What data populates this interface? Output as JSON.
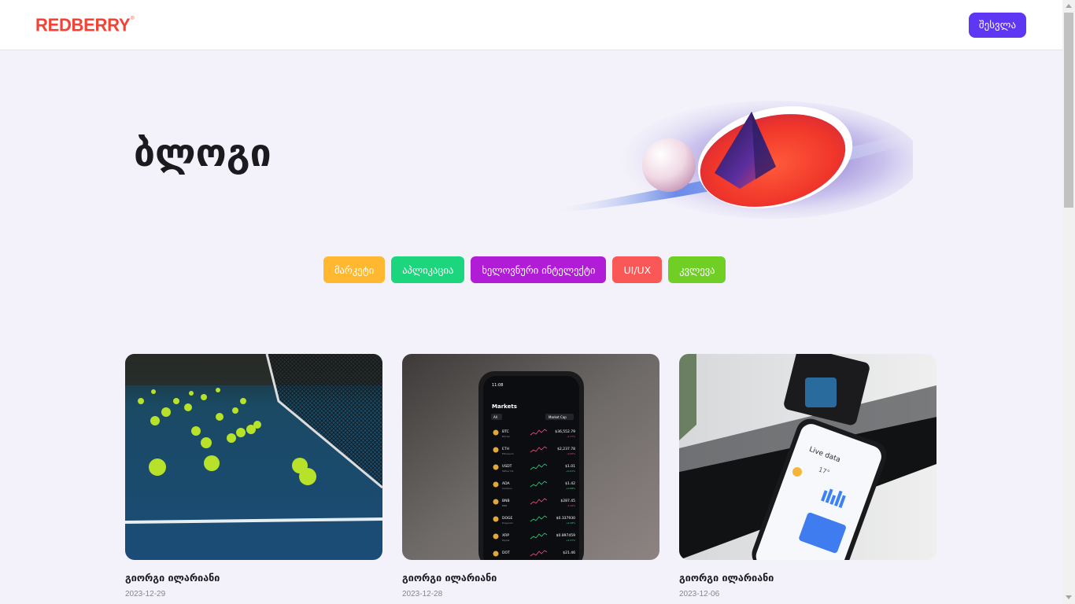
{
  "header": {
    "logo_text": "REDBERRY",
    "logo_mark": "®",
    "login_label": "შესვლა"
  },
  "hero": {
    "title": "ბლოგი"
  },
  "categories": [
    {
      "label": "მარკეტი",
      "color": "#FFB82F"
    },
    {
      "label": "აპლიკაცია",
      "color": "#1CD67D"
    },
    {
      "label": "ხელოვნური ინტელექტი",
      "color": "#B11CD6"
    },
    {
      "label": "UI/UX",
      "color": "#FA5757"
    },
    {
      "label": "კვლევა",
      "color": "#70CF25"
    }
  ],
  "posts": [
    {
      "author": "გიორგი ილარიანი",
      "date": "2023-12-29",
      "image": "tennis-balls-photo"
    },
    {
      "author": "გიორგი ილარიანი",
      "date": "2023-12-28",
      "image": "crypto-markets-phone-photo",
      "phone": {
        "time": "11:08",
        "title": "Markets",
        "tab_all": "All",
        "filter": "Market Cap",
        "coins": [
          {
            "symbol": "BTC",
            "name": "Bitcoin",
            "price": "$36,552.79",
            "change": "-0.77%"
          },
          {
            "symbol": "ETH",
            "name": "Ethereum",
            "price": "$2,237.78",
            "change": "-0.05%"
          },
          {
            "symbol": "USDT",
            "name": "Tether US",
            "price": "$1.01",
            "change": "+0.01%"
          },
          {
            "symbol": "ADA",
            "name": "Cardano",
            "price": "$1.42",
            "change": "+0.68%"
          },
          {
            "symbol": "BNB",
            "name": "BNB",
            "price": "$287.45",
            "change": "-1.44%"
          },
          {
            "symbol": "DOGE",
            "name": "Dogecoin",
            "price": "$0.337930",
            "change": "+2.08%"
          },
          {
            "symbol": "XRP",
            "name": "Ripple",
            "price": "$0.897459",
            "change": "+2.47%"
          },
          {
            "symbol": "DOT",
            "name": "",
            "price": "$21.46",
            "change": ""
          }
        ]
      }
    },
    {
      "author": "გიორგი ილარიანი",
      "date": "2023-12-06",
      "image": "live-data-phone-photo",
      "phone": {
        "title": "Live data",
        "temperature": "17°"
      }
    }
  ],
  "colors": {
    "accent": "#5D37F3",
    "logo": "#F44336",
    "background": "#F3F2FA",
    "text": "#1A1A1F",
    "muted": "#85858D"
  }
}
